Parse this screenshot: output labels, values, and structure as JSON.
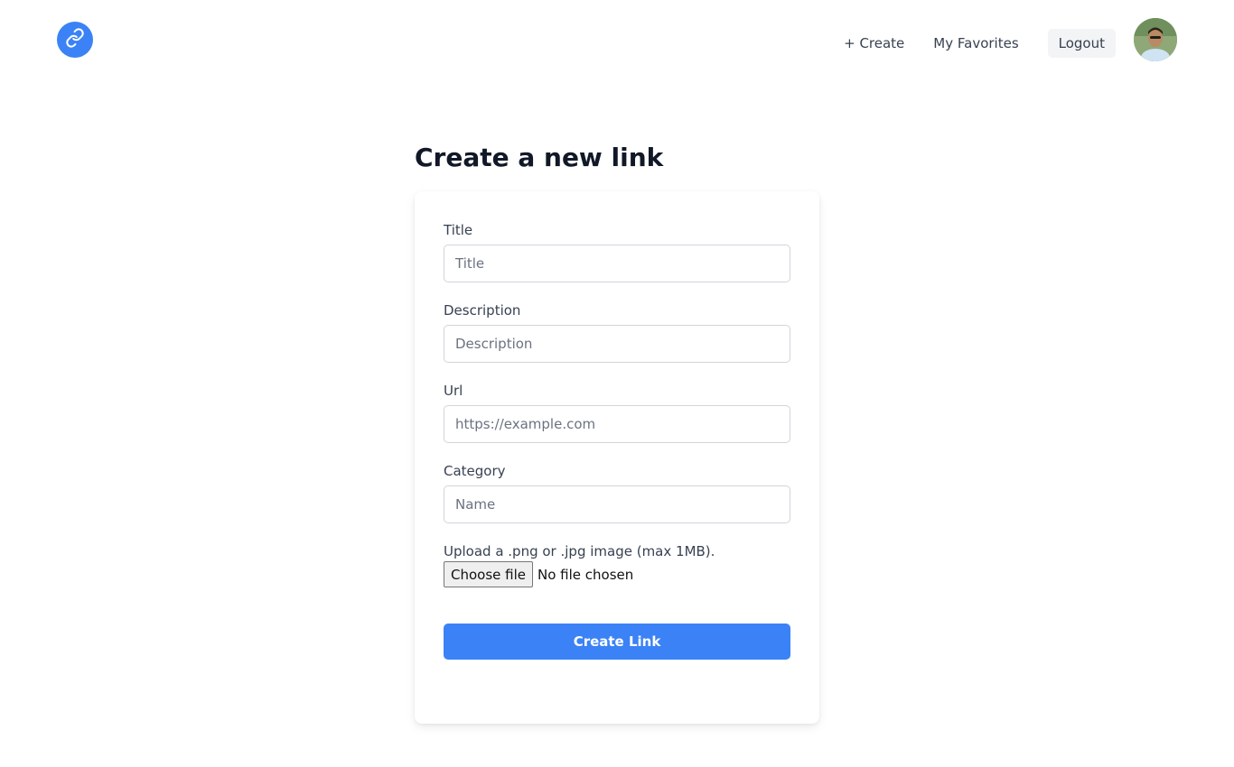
{
  "header": {
    "logo_icon": "link-icon",
    "nav": {
      "create_label": "+ Create",
      "favorites_label": "My Favorites",
      "logout_label": "Logout"
    },
    "avatar_icon": "user-avatar"
  },
  "page": {
    "title": "Create a new link"
  },
  "form": {
    "title_label": "Title",
    "title_placeholder": "Title",
    "description_label": "Description",
    "description_placeholder": "Description",
    "url_label": "Url",
    "url_placeholder": "https://example.com",
    "category_label": "Category",
    "category_placeholder": "Name",
    "upload_note": "Upload a .png or .jpg image (max 1MB).",
    "choose_file_label": "Choose file",
    "file_status": "No file chosen",
    "submit_label": "Create Link"
  },
  "colors": {
    "accent": "#3b82f6",
    "background": "#ffffff"
  }
}
